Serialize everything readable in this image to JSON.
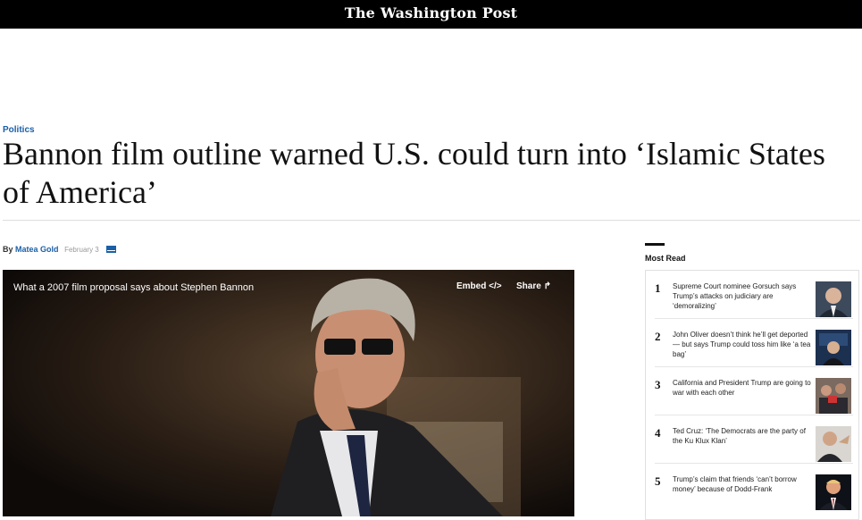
{
  "header": {
    "logo_text": "The Washington Post"
  },
  "article": {
    "section": "Politics",
    "headline": "Bannon film outline warned U.S. could turn into ‘Islamic States of America’",
    "byline_prefix": "By",
    "author": "Matea Gold",
    "date": "February 3"
  },
  "video": {
    "title": "What a 2007 film proposal says about Stephen Bannon",
    "embed_label": "Embed </>",
    "share_label": "Share ↱"
  },
  "most_read": {
    "title": "Most Read",
    "items": [
      {
        "num": "1",
        "text": "Supreme Court nominee Gorsuch says Trump’s attacks on judiciary are ‘demoralizing’"
      },
      {
        "num": "2",
        "text": "John Oliver doesn’t think he’ll get deported — but says Trump could toss him like ‘a tea bag’"
      },
      {
        "num": "3",
        "text": "California and President Trump are going to war with each other"
      },
      {
        "num": "4",
        "text": "Ted Cruz: ‘The Democrats are the party of the Ku Klux Klan’"
      },
      {
        "num": "5",
        "text": "Trump’s claim that friends ‘can’t borrow money’ because of Dodd-Frank"
      }
    ]
  }
}
